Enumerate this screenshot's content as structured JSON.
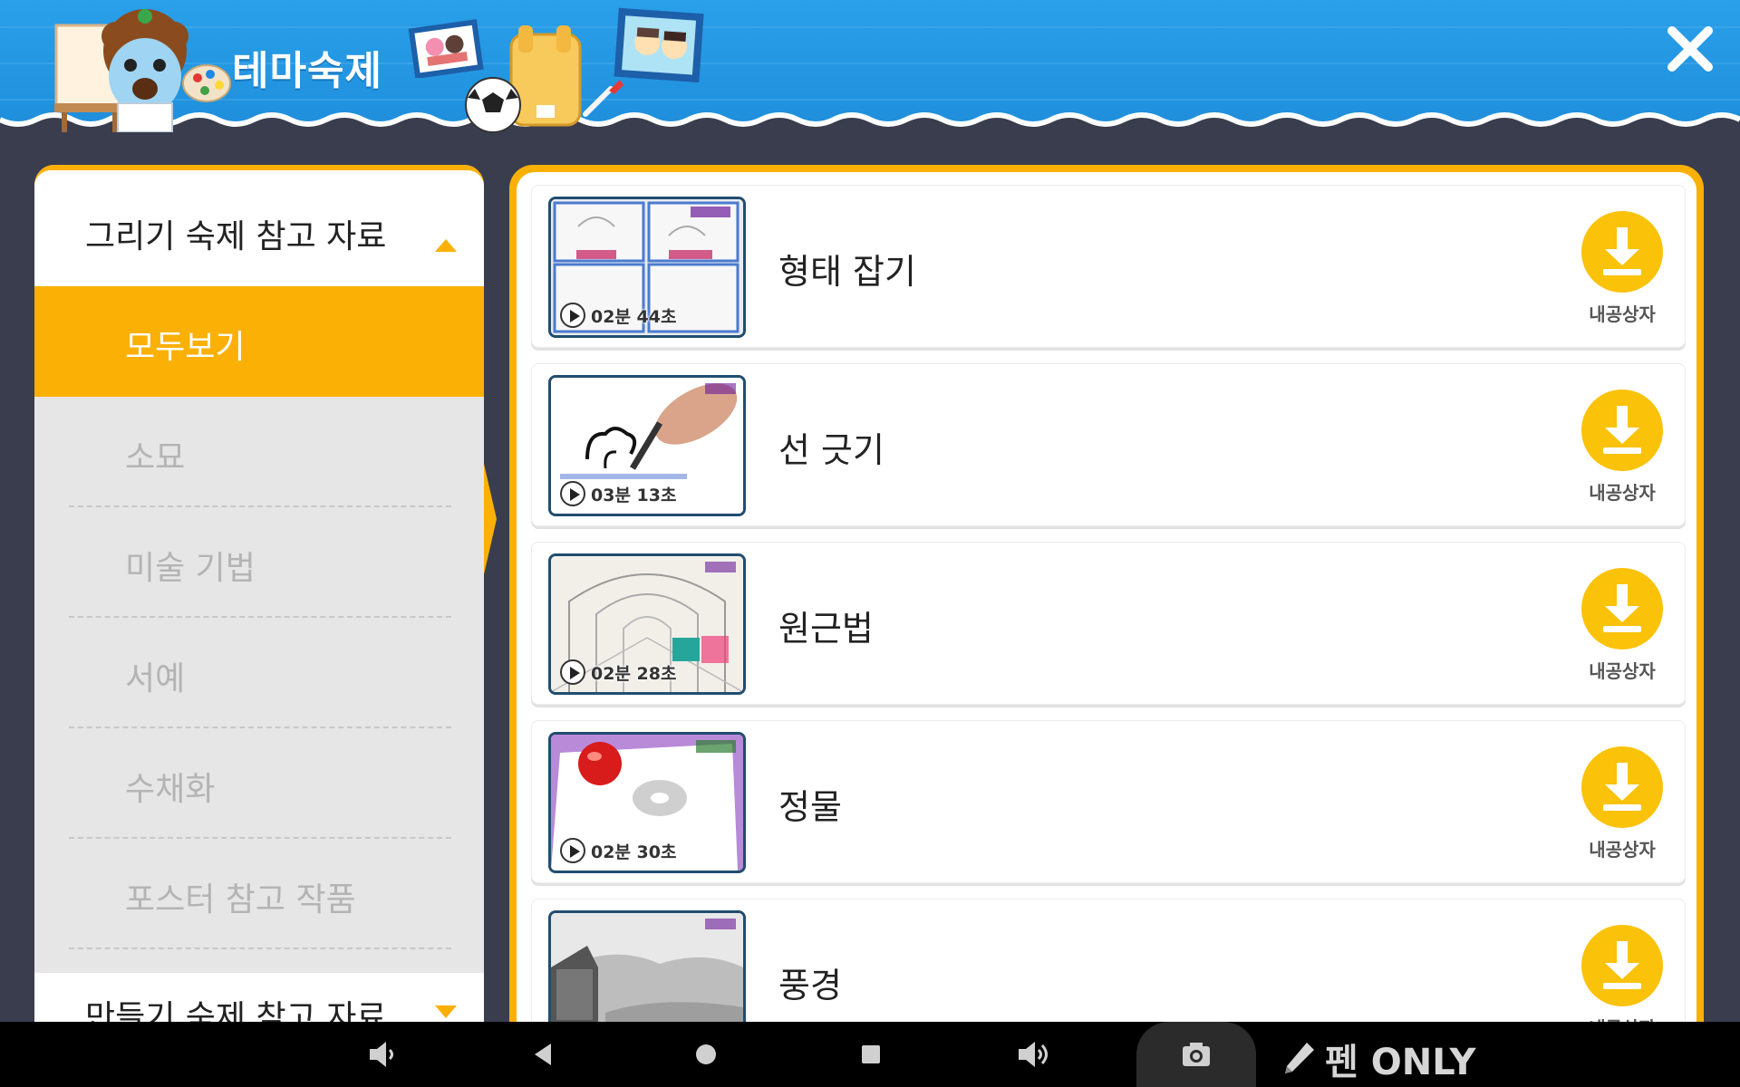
{
  "header": {
    "title": "테마숙제",
    "close_icon": "close-icon",
    "colors": {
      "sky": "#2f9be6",
      "wave": "#ffffff",
      "accent": "#fbb006"
    }
  },
  "sidebar": {
    "category_1": {
      "label": "그리기 숙제 참고 자료",
      "expanded": true
    },
    "items": [
      {
        "label": "모두보기",
        "active": true
      },
      {
        "label": "소묘",
        "active": false
      },
      {
        "label": "미술 기법",
        "active": false
      },
      {
        "label": "서예",
        "active": false
      },
      {
        "label": "수채화",
        "active": false
      },
      {
        "label": "포스터 참고 작품",
        "active": false
      }
    ],
    "category_2": {
      "label": "만들기 숙제 참고 자료",
      "expanded": false
    }
  },
  "videos": [
    {
      "title": "형태 잡기",
      "duration": "02분 44초",
      "download_label": "내공상자"
    },
    {
      "title": "선 긋기",
      "duration": "03분 13초",
      "download_label": "내공상자"
    },
    {
      "title": "원근법",
      "duration": "02분 28초",
      "download_label": "내공상자"
    },
    {
      "title": "정물",
      "duration": "02분 30초",
      "download_label": "내공상자"
    },
    {
      "title": "풍경",
      "duration": "",
      "download_label": "내공상자"
    }
  ],
  "navbar": {
    "icons": [
      "volume-down-icon",
      "back-icon",
      "home-icon",
      "recents-icon",
      "volume-up-icon",
      "camera-icon",
      "pencil-icon"
    ],
    "pen_label": "펜 ONLY"
  }
}
